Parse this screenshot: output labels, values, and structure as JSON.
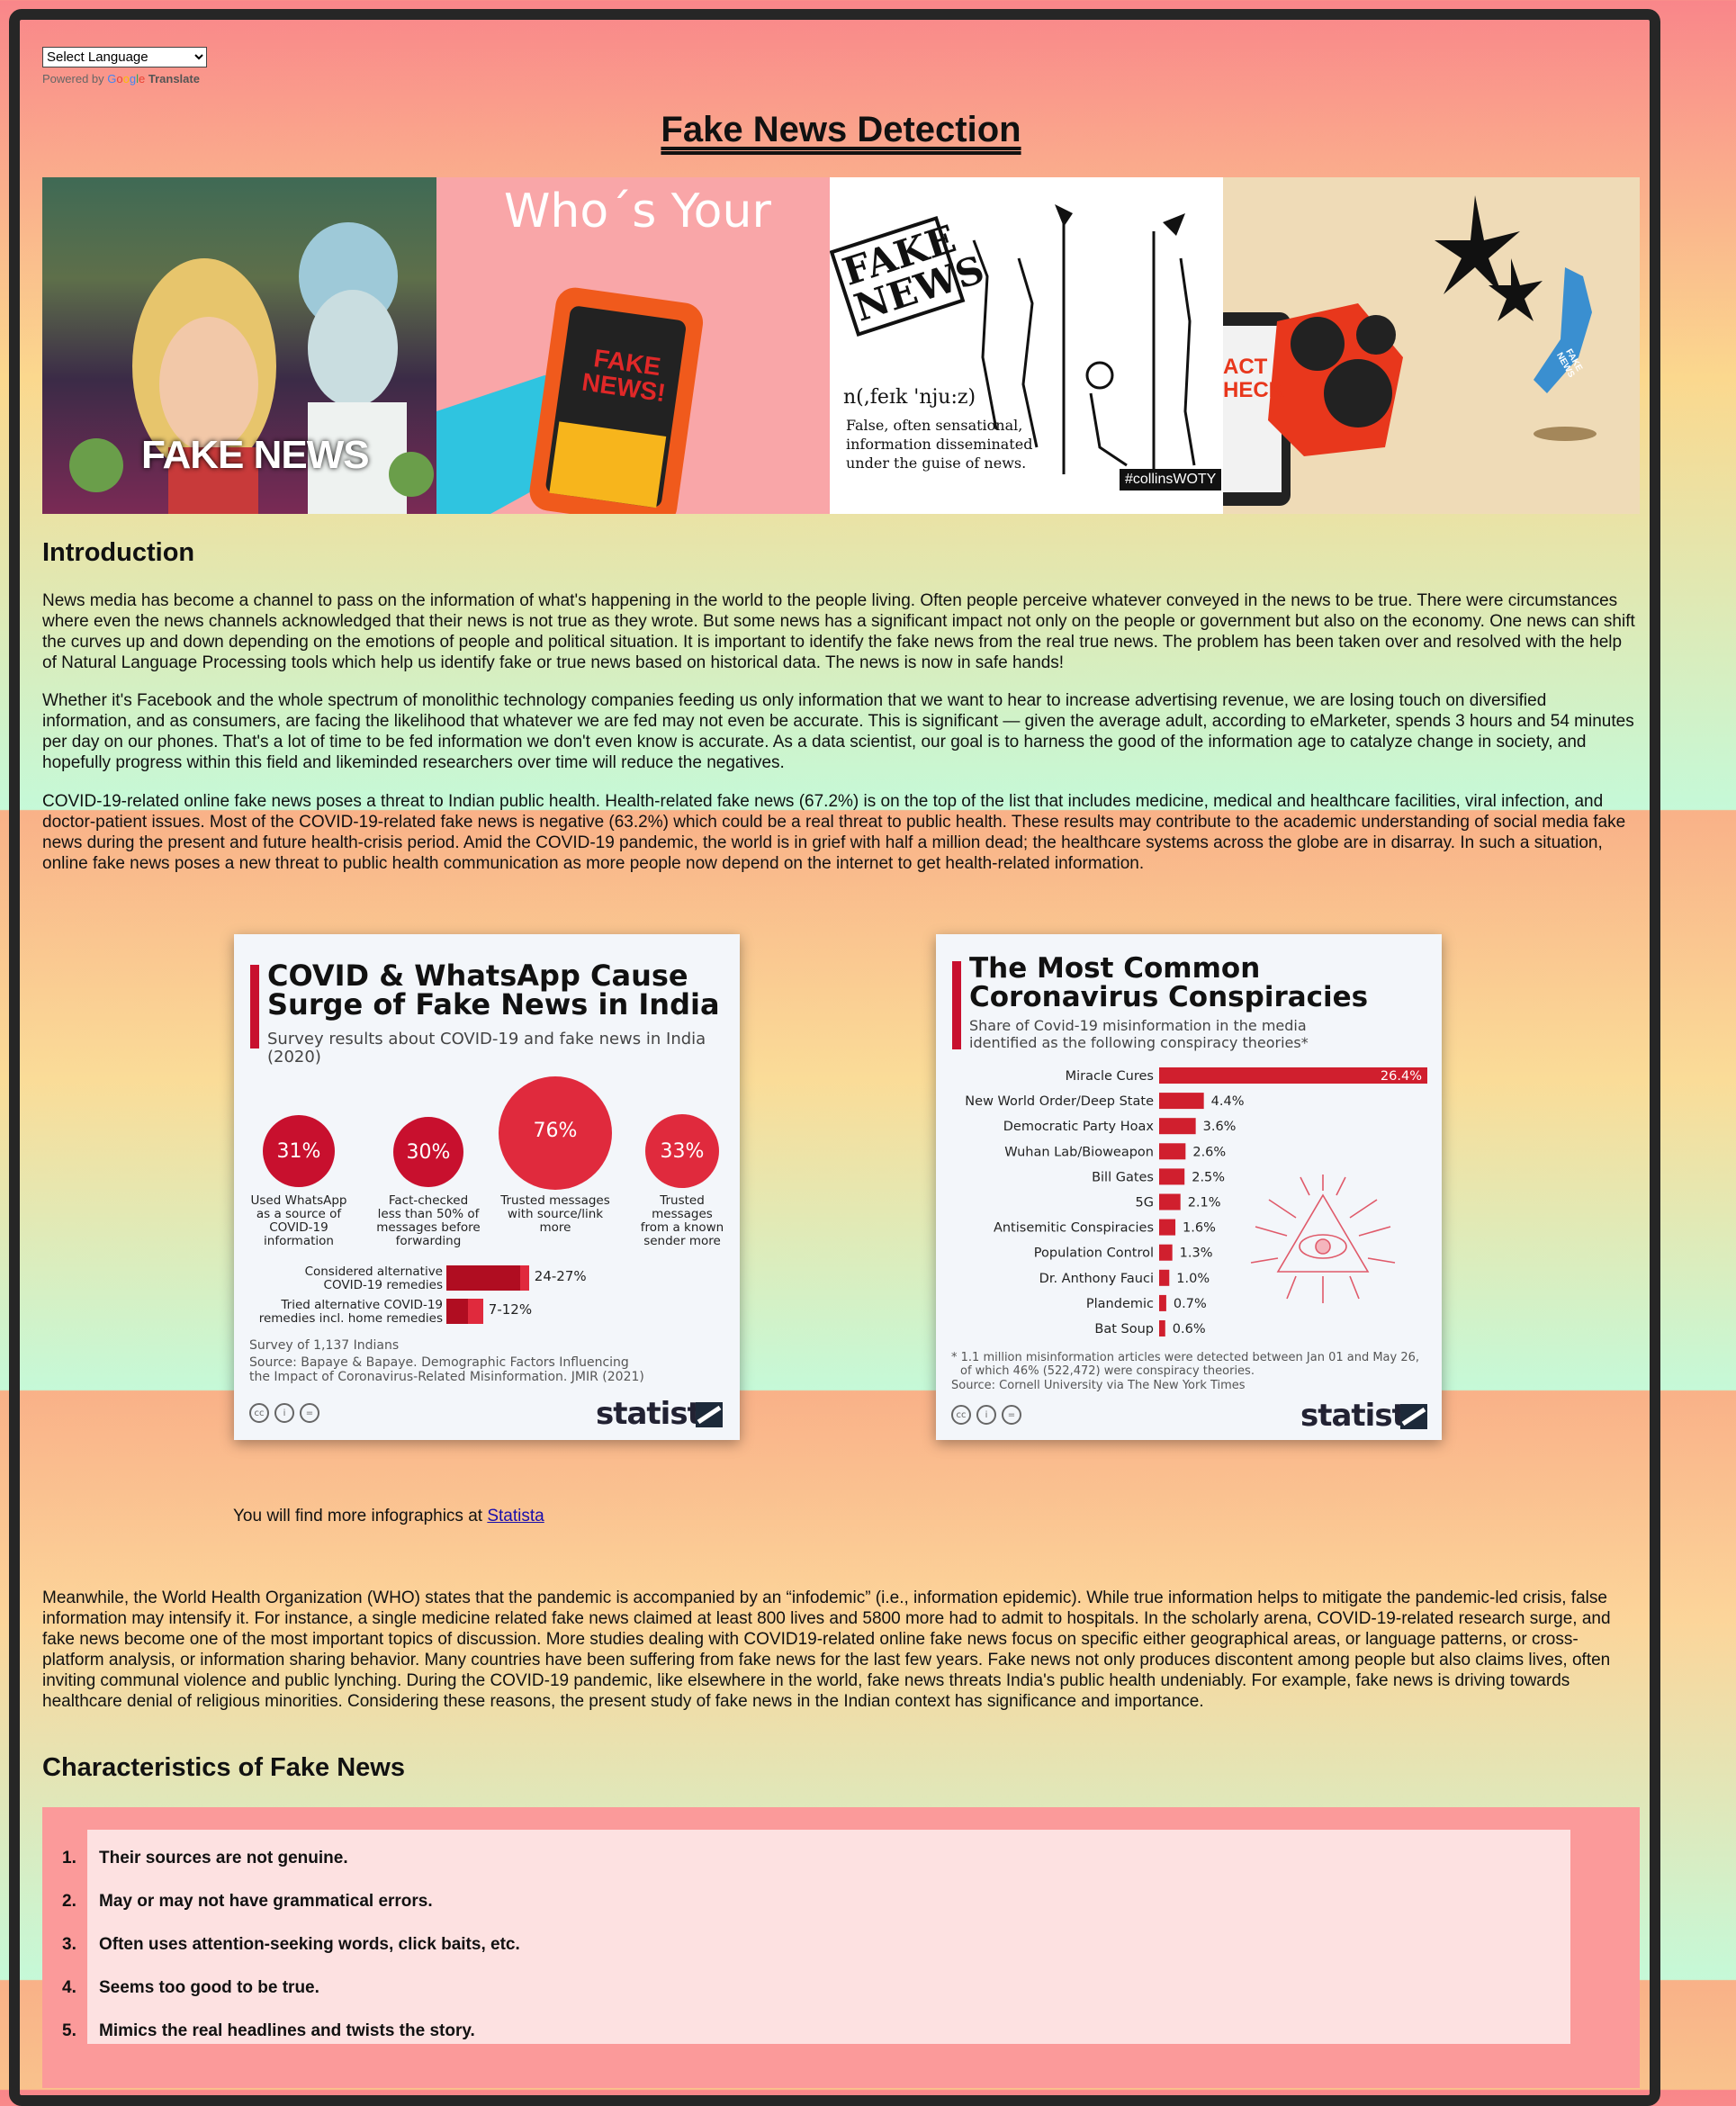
{
  "header": {
    "language_select": "Select Language",
    "powered_by": "Powered by",
    "google": [
      "G",
      "o",
      "o",
      "g",
      "l",
      "e"
    ],
    "translate": "Translate",
    "title": "Fake News Detection"
  },
  "banner": {
    "panel1_caption": "FAKE NEWS",
    "panel2_heading": "Who´s Your",
    "panel2_phone_text": "FAKE NEWS!",
    "panel3_stamp": "FAKE NEWS",
    "panel3_phonetic": "n(,feɪk 'nju:z)",
    "panel3_definition": [
      "False, often sensational,",
      "information disseminated",
      "under the guise of news."
    ],
    "panel3_tag": "#collinsWOTY",
    "panel4_check": [
      "ACT",
      "HECK"
    ],
    "panel4_badge": "FAKE NEWS"
  },
  "intro": {
    "heading": "Introduction",
    "p1": "News media has become a channel to pass on the information of what's happening in the world to the people living. Often people perceive whatever conveyed in the news to be true. There were circumstances where even the news channels acknowledged that their news is not true as they wrote. But some news has a significant impact not only on the people or government but also on the economy. One news can shift the curves up and down depending on the emotions of people and political situation. It is important to identify the fake news from the real true news. The problem has been taken over and resolved with the help of Natural Language Processing tools which help us identify fake or true news based on historical data. The news is now in safe hands!",
    "p2": "Whether it's Facebook and the whole spectrum of monolithic technology companies feeding us only information that we want to hear to increase advertising revenue, we are losing touch on diversified information, and as consumers, are facing the likelihood that whatever we are fed may not even be accurate. This is significant — given the average adult, according to eMarketer, spends 3 hours and 54 minutes per day on our phones. That's a lot of time to be fed information we don't even know is accurate. As a data scientist, our goal is to harness the good of the information age to catalyze change in society, and hopefully progress within this field and likeminded researchers over time will reduce the negatives.",
    "p3": "COVID-19-related online fake news poses a threat to Indian public health. Health-related fake news (67.2%) is on the top of the list that includes medicine, medical and healthcare facilities, viral infection, and doctor-patient issues. Most of the COVID-19-related fake news is negative (63.2%) which could be a real threat to public health. These results may contribute to the academic understanding of social media fake news during the present and future health-crisis period. Amid the COVID-19 pandemic, the world is in grief with half a million dead; the healthcare systems across the globe are in disarray. In such a situation, online fake news poses a new threat to public health communication as more people now depend on the internet to get health-related information."
  },
  "infographic1": {
    "title_line1": "COVID & WhatsApp Cause",
    "title_line2": "Surge of Fake News in India",
    "subtitle": "Survey results about COVID-19 and fake news in India (2020)",
    "bubbles": [
      {
        "value": "31%",
        "label": [
          "Used WhatsApp",
          "as a source of",
          "COVID-19",
          "information"
        ]
      },
      {
        "value": "30%",
        "label": [
          "Fact-checked",
          "less than 50% of",
          "messages before",
          "forwarding"
        ]
      },
      {
        "value": "76%",
        "label": [
          "Trusted messages",
          "with source/link",
          "more"
        ]
      },
      {
        "value": "33%",
        "label": [
          "Trusted",
          "messages",
          "from a known",
          "sender more"
        ]
      }
    ],
    "bars": [
      {
        "label": [
          "Considered alternative",
          "COVID-19 remedies"
        ],
        "value": "24-27%",
        "low": 24,
        "high": 27
      },
      {
        "label": [
          "Tried alternative COVID-19",
          "remedies incl. home remedies"
        ],
        "value": "7-12%",
        "low": 7,
        "high": 12
      }
    ],
    "survey": "Survey of 1,137 Indians",
    "source_line1": "Source: Bapaye & Bapaye. Demographic Factors Influencing",
    "source_line2": "the Impact of Coronavirus-Related Misinformation. JMIR (2021)",
    "logo": "statista"
  },
  "infographic2": {
    "title_line1": "The Most Common",
    "title_line2": "Coronavirus Conspiracies",
    "subtitle_line1": "Share of Covid-19 misinformation in the media",
    "subtitle_line2": "identified as the following conspiracy theories*",
    "chart_data": {
      "type": "bar",
      "orientation": "horizontal",
      "categories": [
        "Miracle Cures",
        "New World Order/Deep State",
        "Democratic Party Hoax",
        "Wuhan Lab/Bioweapon",
        "Bill Gates",
        "5G",
        "Antisemitic Conspiracies",
        "Population Control",
        "Dr. Anthony Fauci",
        "Plandemic",
        "Bat Soup"
      ],
      "values": [
        26.4,
        4.4,
        3.6,
        2.6,
        2.5,
        2.1,
        1.6,
        1.3,
        1.0,
        0.7,
        0.6
      ],
      "labels": [
        "26.4%",
        "4.4%",
        "3.6%",
        "2.6%",
        "2.5%",
        "2.1%",
        "1.6%",
        "1.3%",
        "1.0%",
        "0.7%",
        "0.6%"
      ],
      "bar_color": "#d01f2e"
    },
    "footnote_line1": "* 1.1 million misinformation articles were detected between Jan 01 and May 26,",
    "footnote_line2": "of which 46% (522,472) were conspiracy theories.",
    "source": "Source: Cornell University via The New York Times",
    "logo": "statista"
  },
  "more_infographics": {
    "text": "You will find more infographics at ",
    "link": "Statista"
  },
  "p4": "Meanwhile, the World Health Organization (WHO) states that the pandemic is accompanied by an “infodemic” (i.e., information epidemic). While true information helps to mitigate the pandemic-led crisis, false information may intensify it. For instance, a single medicine related fake news claimed at least 800 lives and 5800 more had to admit to hospitals. In the scholarly arena, COVID-19-related research surge, and fake news become one of the most important topics of discussion. More studies dealing with COVID19-related online fake news focus on specific either geographical areas, or language patterns, or cross-platform analysis, or information sharing behavior. Many countries have been suffering from fake news for the last few years. Fake news not only produces discontent among people but also claims lives, often inviting communal violence and public lynching. During the COVID-19 pandemic, like elsewhere in the world, fake news threats India's public health undeniably. For example, fake news is driving towards healthcare denial of religious minorities. Considering these reasons, the present study of fake news in the Indian context has significance and importance.",
  "characteristics": {
    "heading": "Characteristics of Fake News",
    "items": [
      {
        "num": "1.",
        "text": "Their sources are not genuine."
      },
      {
        "num": "2.",
        "text": "May or may not have grammatical errors."
      },
      {
        "num": "3.",
        "text": "Often uses attention-seeking words, click baits, etc."
      },
      {
        "num": "4.",
        "text": "Seems too good to be true."
      },
      {
        "num": "5.",
        "text": "Mimics the real headlines and twists the story."
      }
    ]
  }
}
